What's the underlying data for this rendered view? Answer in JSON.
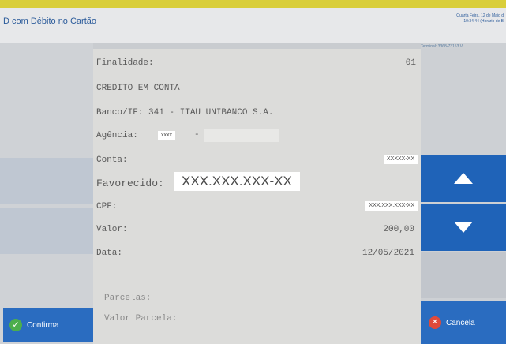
{
  "header": {
    "title": "D com Débito no Cartão",
    "datetime_line1": "Quarta Feira, 12 de Maio d",
    "datetime_line2": "10:34:44 (Horário de B",
    "terminal": "Terminal: 3368-73153 V"
  },
  "receipt": {
    "finalidade_label": "Finalidade:",
    "finalidade_value": "01",
    "tipo": "CREDITO EM CONTA",
    "banco": "Banco/IF: 341 - ITAU UNIBANCO S.A.",
    "agencia_label": "Agência:",
    "agencia_value": "xxxx",
    "agencia_sep": "-",
    "conta_label": "Conta:",
    "conta_value": "XXXXX-XX",
    "favorecido_label": "Favorecido:",
    "favorecido_value": "XXX.XXX.XXX-XX",
    "cpf_label": "CPF:",
    "cpf_value": "XXX.XXX.XXX-XX",
    "valor_label": "Valor:",
    "valor_value": "200,00",
    "data_label": "Data:",
    "data_value": "12/05/2021",
    "parcelas_label": "Parcelas:",
    "valor_parcela_label": "Valor Parcela:"
  },
  "buttons": {
    "confirm_label": "Confirma",
    "cancel_label": "Cancela",
    "up_icon": "arrow-up-icon",
    "down_icon": "arrow-down-icon"
  },
  "colors": {
    "accent_blue": "#1f63b8",
    "top_bar_yellow": "#d9ce3a",
    "confirm_green": "#4cae4c",
    "cancel_red": "#e04a3a"
  }
}
